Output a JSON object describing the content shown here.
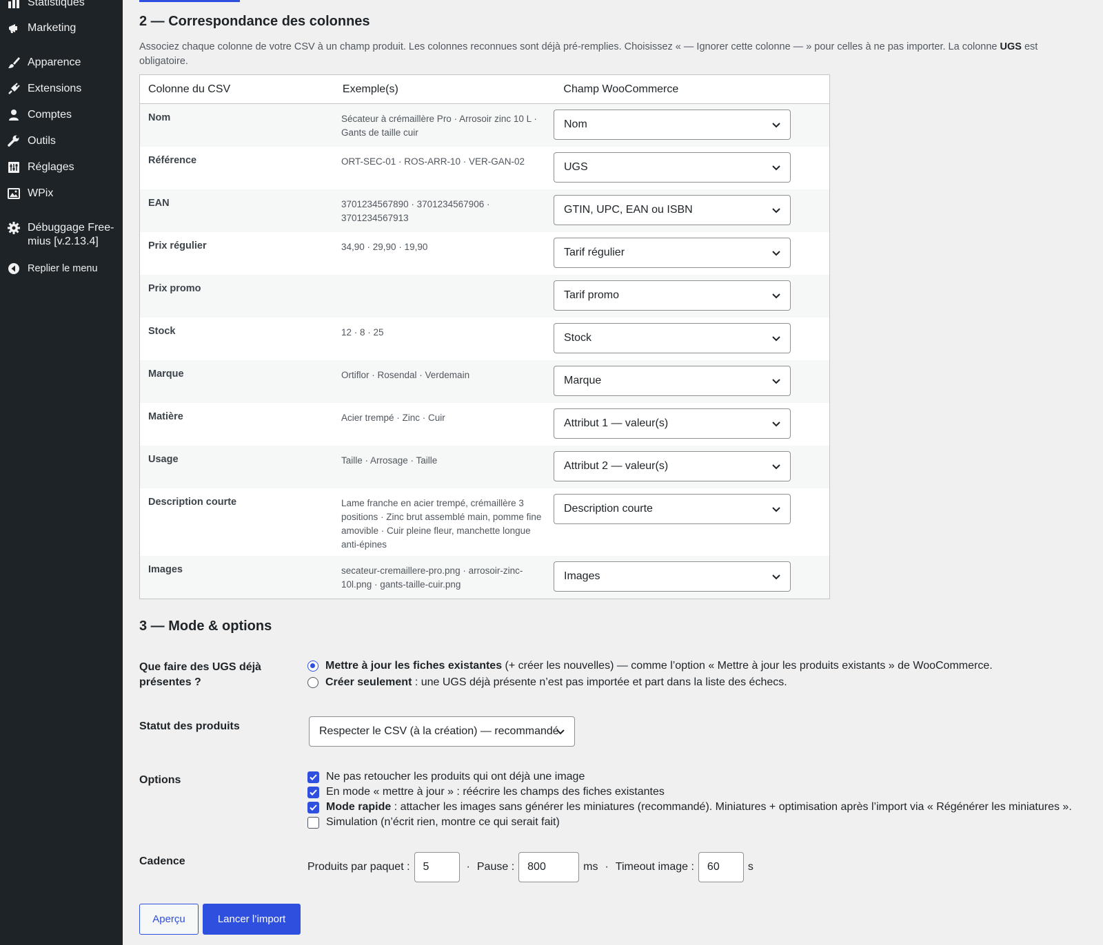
{
  "sidebar": {
    "items": [
      {
        "label": "Statistiques",
        "icon": "bar-chart-icon"
      },
      {
        "label": "Marketing",
        "icon": "megaphone-icon"
      },
      {
        "label": "Apparence",
        "icon": "paintbrush-icon"
      },
      {
        "label": "Extensions",
        "icon": "plug-icon"
      },
      {
        "label": "Comptes",
        "icon": "user-icon"
      },
      {
        "label": "Outils",
        "icon": "wrench-icon"
      },
      {
        "label": "Réglages",
        "icon": "settings-sliders-icon"
      },
      {
        "label": "WPix",
        "icon": "image-icon"
      },
      {
        "label": "Débuggage Free-mius [v.2.13.4]",
        "icon": "gear-icon"
      },
      {
        "label": "Replier le menu",
        "icon": "collapse-arrow-icon"
      }
    ]
  },
  "mapping": {
    "title": "2 — Correspondance des colonnes",
    "description_before": "Associez chaque colonne de votre CSV à un champ produit. Les colonnes reconnues sont déjà pré-remplies. Choisissez « — Ignorer cette colonne — » pour celles à ne pas importer. La colonne ",
    "description_bold": "UGS",
    "description_after": " est obligatoire.",
    "headers": {
      "csv": "Colonne du CSV",
      "example": "Exemple(s)",
      "field": "Champ WooCommerce"
    },
    "rows": [
      {
        "name": "Nom",
        "example": "Sécateur à crémaillère Pro · Arrosoir zinc 10 L · Gants de taille cuir",
        "field": "Nom"
      },
      {
        "name": "Référence",
        "example": "ORT-SEC-01 · ROS-ARR-10 · VER-GAN-02",
        "field": "UGS"
      },
      {
        "name": "EAN",
        "example": "3701234567890 · 3701234567906 · 3701234567913",
        "field": "GTIN, UPC, EAN ou ISBN"
      },
      {
        "name": "Prix régulier",
        "example": "34,90 · 29,90 · 19,90",
        "field": "Tarif régulier"
      },
      {
        "name": "Prix promo",
        "example": "",
        "field": "Tarif promo"
      },
      {
        "name": "Stock",
        "example": "12 · 8 · 25",
        "field": "Stock"
      },
      {
        "name": "Marque",
        "example": "Ortiflor · Rosendal · Verdemain",
        "field": "Marque"
      },
      {
        "name": "Matière",
        "example": "Acier trempé · Zinc · Cuir",
        "field": "Attribut 1 — valeur(s)"
      },
      {
        "name": "Usage",
        "example": "Taille · Arrosage · Taille",
        "field": "Attribut 2 — valeur(s)"
      },
      {
        "name": "Description courte",
        "example": "Lame franche en acier trempé, crémaillère 3 positions · Zinc brut assemblé main, pomme fine amovible · Cuir pleine fleur, manchette longue anti-épines",
        "field": "Description courte"
      },
      {
        "name": "Images",
        "example": "secateur-cremaillere-pro.png · arrosoir-zinc-10l.png · gants-taille-cuir.png",
        "field": "Images"
      }
    ]
  },
  "options": {
    "title": "3 — Mode & options",
    "ugs_label": "Que faire des UGS déjà présentes ?",
    "radio_update_bold": "Mettre à jour les fiches existantes",
    "radio_update_rest": " (+ créer les nouvelles) — comme l’option « Mettre à jour les produits existants » de WooCommerce.",
    "radio_create_bold": "Créer seulement",
    "radio_create_rest": " : une UGS déjà présente n’est pas importée et part dans la liste des échecs.",
    "radio_selected": "update",
    "status_label": "Statut des produits",
    "status_value": "Respecter le CSV (à la création) — recommandé",
    "options_label": "Options",
    "check1": {
      "text": "Ne pas retoucher les produits qui ont déjà une image",
      "checked": true
    },
    "check2": {
      "text": "En mode « mettre à jour » : réécrire les champs des fiches existantes",
      "checked": true
    },
    "check3": {
      "bold": "Mode rapide",
      "text": " : attacher les images sans générer les miniatures (recommandé). Miniatures + optimisation après l’import via « Régénérer les miniatures ».",
      "checked": true
    },
    "check4": {
      "text": "Simulation (n’écrit rien, montre ce qui serait fait)",
      "checked": false
    },
    "cadence_label": "Cadence",
    "per_batch_label": "Produits par paquet :",
    "per_batch_value": "5",
    "sep1": "·",
    "pause_label": "Pause :",
    "pause_value": "800",
    "pause_unit": "ms",
    "sep2": "·",
    "timeout_label": "Timeout image :",
    "timeout_value": "60",
    "timeout_unit": "s"
  },
  "buttons": {
    "preview": "Aperçu",
    "launch": "Lancer l’import"
  },
  "colors": {
    "accent": "#2f4fde",
    "sidebar_bg": "#1d2327",
    "page_bg": "#f0f0f1"
  }
}
